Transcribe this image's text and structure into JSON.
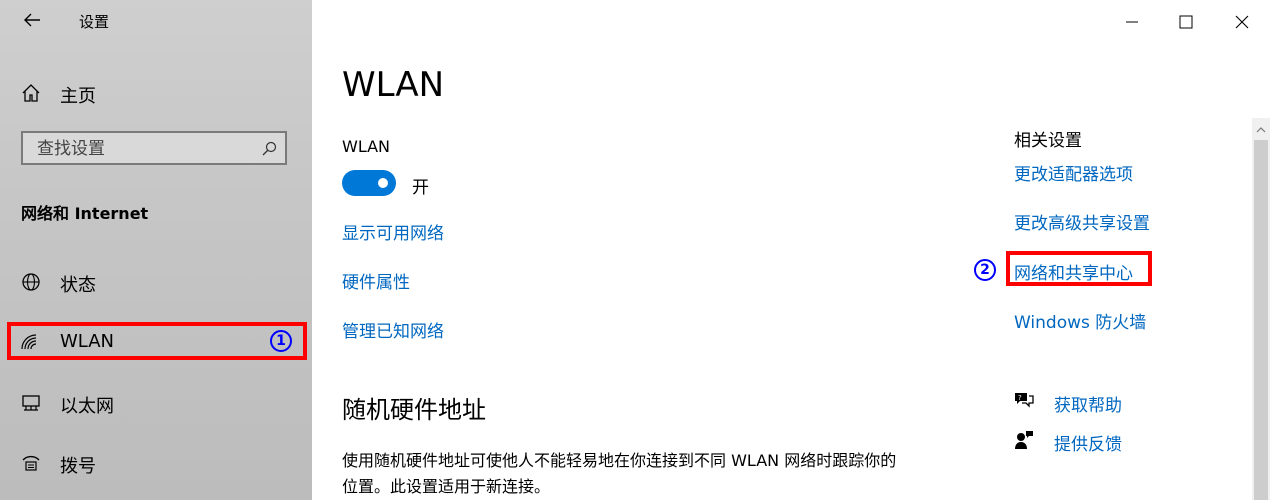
{
  "window": {
    "title": "设置",
    "controls": [
      "minimize-icon",
      "maximize-icon",
      "close-icon"
    ]
  },
  "sidebar": {
    "home_label": "主页",
    "search_placeholder": "查找设置",
    "section_title": "网络和 Internet",
    "items": [
      {
        "label": "状态",
        "icon": "globe-icon"
      },
      {
        "label": "WLAN",
        "icon": "wifi-icon",
        "selected": true
      },
      {
        "label": "以太网",
        "icon": "ethernet-icon"
      },
      {
        "label": "拨号",
        "icon": "dialup-icon"
      }
    ]
  },
  "annotations": {
    "marker1": "1",
    "marker2": "2",
    "highlight_color": "#ff0000",
    "marker_color": "#0000ff"
  },
  "main": {
    "title": "WLAN",
    "wlan_label": "WLAN",
    "toggle_state": "开",
    "toggle_on": true,
    "links": [
      "显示可用网络",
      "硬件属性",
      "管理已知网络"
    ],
    "random_hw_title": "随机硬件地址",
    "random_hw_desc": "使用随机硬件地址可使他人不能轻易地在你连接到不同 WLAN 网络时跟踪你的位置。此设置适用于新连接。"
  },
  "related": {
    "title": "相关设置",
    "links": [
      "更改适配器选项",
      "更改高级共享设置",
      "网络和共享中心",
      "Windows 防火墙"
    ],
    "help_label": "获取帮助",
    "feedback_label": "提供反馈"
  },
  "colors": {
    "accent": "#0078d7",
    "link": "#0067c0"
  }
}
